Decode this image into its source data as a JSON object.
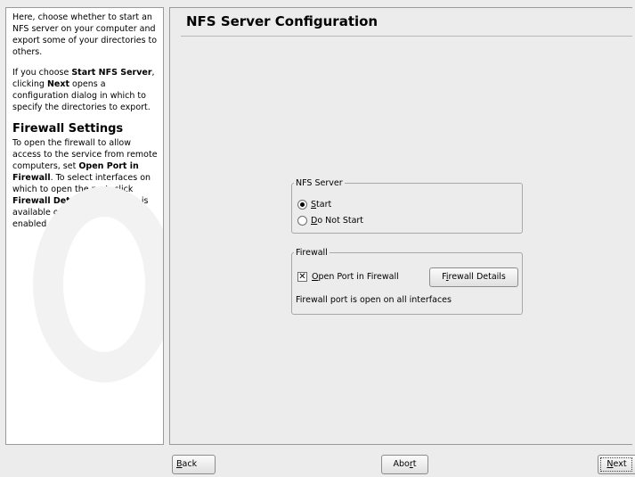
{
  "help": {
    "p1": "Here, choose whether to start an NFS server on your computer and export some of your directories to others.",
    "p2_pre": "If you choose ",
    "p2_b1": "Start NFS Server",
    "p2_mid": ", clicking ",
    "p2_b2": "Next",
    "p2_post": " opens a configuration dialog in which to specify the directories to export.",
    "fw_heading": "Firewall Settings",
    "fw_pre": "To open the firewall to allow access to the service from remote computers, set ",
    "fw_b1": "Open Port in Firewall",
    "fw_mid": ". To select interfaces on which to open the port, click ",
    "fw_b2": "Firewall Details",
    "fw_post": ". This option is available only if the firewall is enabled."
  },
  "main": {
    "title": "NFS Server Configuration",
    "nfs_group": {
      "legend": "NFS Server",
      "start_label": "Start",
      "start_access": "S",
      "start_rest": "tart",
      "not_start_access": "D",
      "not_start_rest": "o Not Start",
      "selected": "Start"
    },
    "fw_group": {
      "legend": "Firewall",
      "open_port_access": "O",
      "open_port_rest": "pen Port in Firewall",
      "open_port_checked": true,
      "details_pre": "F",
      "details_access": "i",
      "details_rest": "rewall Details",
      "status": "Firewall port is open on all interfaces"
    }
  },
  "footer": {
    "back_access": "B",
    "back_rest": "ack",
    "abort_pre": "Abo",
    "abort_access": "r",
    "abort_rest": "t",
    "next_access": "N",
    "next_rest": "ext"
  }
}
